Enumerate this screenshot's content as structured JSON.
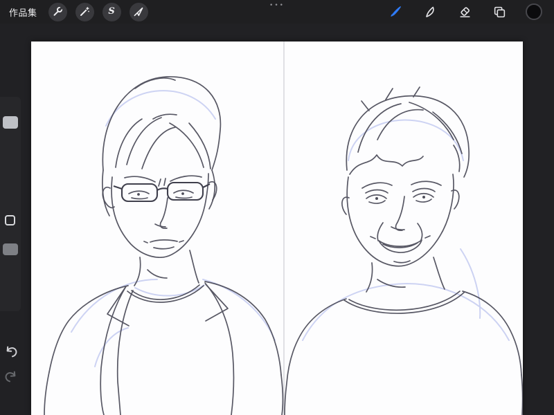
{
  "topbar": {
    "gallery_button": "作品集",
    "multitask_dots": "•••",
    "selection_glyph": "S",
    "left_tools": [
      {
        "label": "actions",
        "icon": "wrench-icon"
      },
      {
        "label": "adjustments",
        "icon": "magic-wand-icon"
      },
      {
        "label": "selection",
        "icon": "s-glyph-icon"
      },
      {
        "label": "transform",
        "icon": "cursor-arrow-icon"
      }
    ],
    "right_tools": [
      {
        "label": "paint",
        "icon": "paintbrush-icon",
        "active": true
      },
      {
        "label": "smudge",
        "icon": "smudge-icon",
        "active": false
      },
      {
        "label": "erase",
        "icon": "eraser-icon",
        "active": false
      },
      {
        "label": "layers",
        "icon": "layers-icon",
        "active": false
      },
      {
        "label": "color",
        "icon": "color-swatch-icon",
        "active": false
      }
    ],
    "colors": {
      "accent": "#2f7bf7",
      "current_color_swatch": "#0b0b0d",
      "bar_background": "#1f1f21"
    }
  },
  "sidebar": {
    "controls": [
      "brush-size-slider",
      "modify-button",
      "opacity-slider",
      "undo-button",
      "redo-button"
    ]
  },
  "canvas": {
    "panels": [
      "left-portrait-sketch",
      "right-portrait-sketch"
    ],
    "colors": {
      "paper": "#fdfdfe",
      "ink": "#4a4a57",
      "underlay_blue": "#b8c1ee",
      "divider": "#d7d7db"
    }
  }
}
